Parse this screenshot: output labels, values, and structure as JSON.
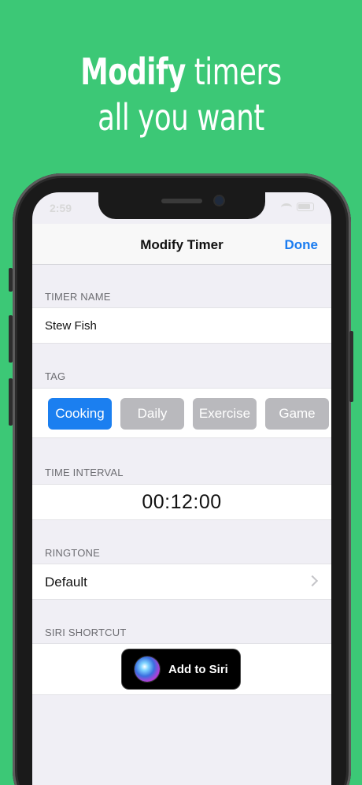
{
  "promo": {
    "headline_bold": "Modify",
    "headline_rest": " timers",
    "headline_line2": "all you want"
  },
  "status_bar": {
    "time": "2:59"
  },
  "navbar": {
    "title": "Modify Timer",
    "done_label": "Done"
  },
  "sections": {
    "timer_name": {
      "label": "TIMER NAME",
      "value": "Stew Fish"
    },
    "tag": {
      "label": "TAG",
      "items": [
        "Cooking",
        "Daily",
        "Exercise",
        "Game"
      ],
      "selected": "Cooking"
    },
    "time_interval": {
      "label": "TIME INTERVAL",
      "value": "00:12:00"
    },
    "ringtone": {
      "label": "RINGTONE",
      "value": "Default"
    },
    "siri_shortcut": {
      "label": "SIRI SHORTCUT",
      "button_label": "Add to Siri"
    }
  },
  "colors": {
    "background": "#3cc876",
    "accent": "#1a7cf0",
    "tag_active": "#1b7ff0",
    "tag_inactive": "#b9b9bd"
  }
}
